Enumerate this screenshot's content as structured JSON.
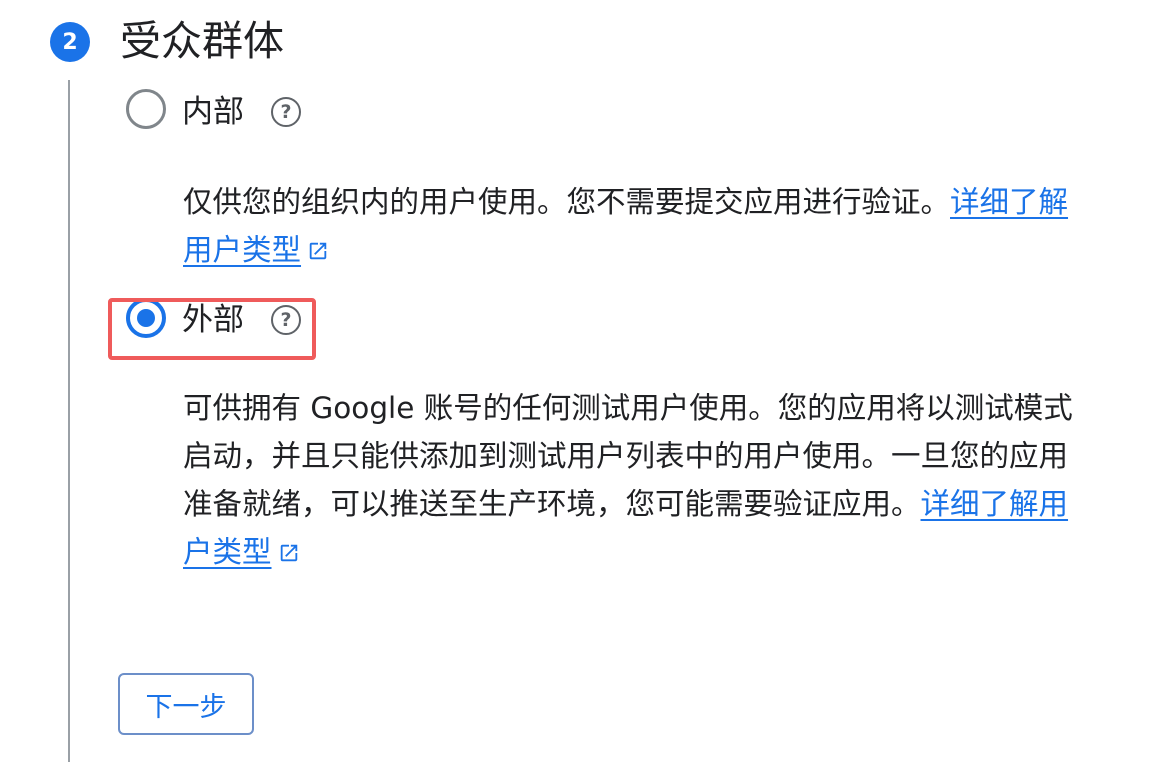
{
  "step": {
    "number": "2",
    "title": "受众群体"
  },
  "options": [
    {
      "label": "内部",
      "selected": false,
      "help_icon": "help-circle-icon",
      "description": "仅供您的组织内的用户使用。您不需要提交应用进行验证。",
      "link_text": "详细了解用户类型"
    },
    {
      "label": "外部",
      "selected": true,
      "help_icon": "help-circle-icon",
      "description": "可供拥有 Google 账号的任何测试用户使用。您的应用将以测试模式启动，并且只能供添加到测试用户列表中的用户使用。一旦您的应用准备就绪，可以推送至生产环境，您可能需要验证应用。",
      "link_text": "详细了解用户类型"
    }
  ],
  "next_button": {
    "label": "下一步"
  },
  "icons": {
    "help": "?",
    "external_link": "open-in-new-icon"
  },
  "colors": {
    "accent": "#1a73e8",
    "highlight": "#ef5b5b",
    "text": "#202124",
    "rail": "#9aa0a6"
  }
}
